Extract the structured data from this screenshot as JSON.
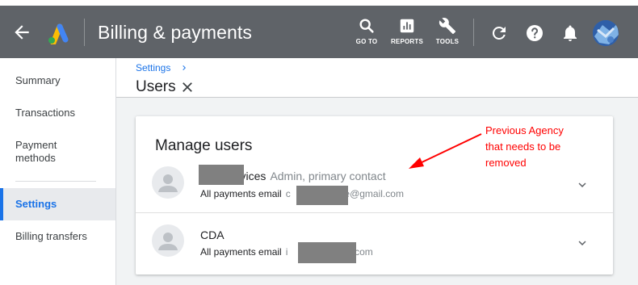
{
  "header": {
    "title": "Billing & payments",
    "tools": [
      {
        "label": "GO TO",
        "icon": "search-icon"
      },
      {
        "label": "REPORTS",
        "icon": "reports-icon"
      },
      {
        "label": "TOOLS",
        "icon": "wrench-icon"
      }
    ],
    "icons": [
      "back-arrow-icon",
      "google-ads-logo",
      "refresh-icon",
      "help-icon",
      "bell-icon",
      "account-avatar"
    ]
  },
  "sidebar": {
    "items": [
      {
        "label": "Summary",
        "active": false
      },
      {
        "label": "Transactions",
        "active": false
      },
      {
        "label": "Payment\nmethods",
        "active": false
      },
      {
        "label": "Settings",
        "active": true
      },
      {
        "label": "Billing transfers",
        "active": false
      }
    ]
  },
  "content": {
    "breadcrumb": "Settings",
    "page_title": "Users"
  },
  "card": {
    "title": "Manage users",
    "users": [
      {
        "name": "e IT Services",
        "role": "Admin, primary contact",
        "email_label": "All payments email",
        "email": "c                    e@gmail.com"
      },
      {
        "name": "CDA",
        "role": "",
        "email_label": "All payments email",
        "email": "i                      it.com"
      }
    ]
  },
  "annotation": {
    "text": "Previous Agency\nthat needs to be\nremoved",
    "color": "#ff0000"
  },
  "colors": {
    "header_bg": "#5f6368",
    "accent": "#1a73e8",
    "redaction": "#808080"
  }
}
